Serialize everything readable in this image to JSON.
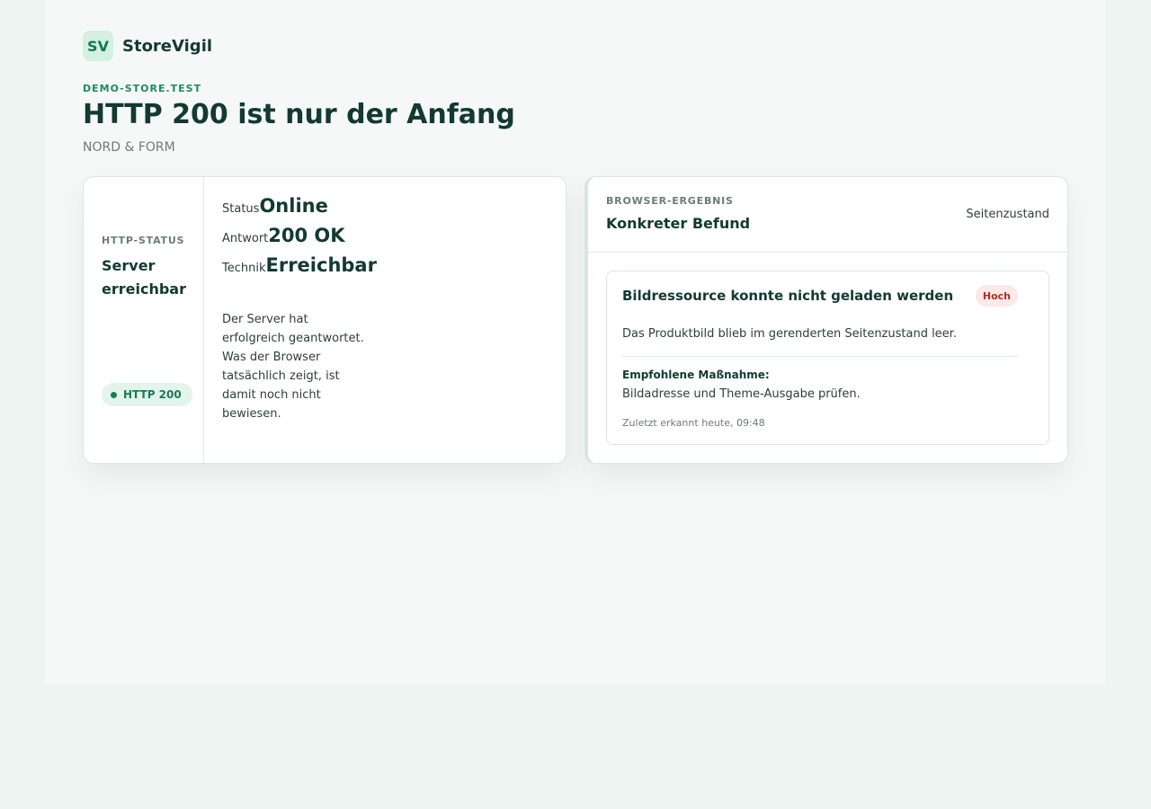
{
  "brand": {
    "logo_text": "SV",
    "name": "StoreVigil"
  },
  "header": {
    "domain": "DEMO-STORE.TEST",
    "title": "HTTP 200 ist nur der Anfang",
    "store_name": "NORD & FORM"
  },
  "http_card": {
    "label": "HTTP-STATUS",
    "title": "Server erreichbar",
    "pill": "HTTP 200",
    "rows": [
      {
        "key": "Status",
        "value": "Online"
      },
      {
        "key": "Antwort",
        "value": "200 OK"
      },
      {
        "key": "Technik",
        "value": "Erreichbar"
      }
    ],
    "description": "Der Server hat erfolgreich geantwortet. Was der Browser tatsächlich zeigt, ist damit noch nicht bewiesen."
  },
  "browser_card": {
    "label": "BROWSER-ERGEBNIS",
    "title": "Konkreter Befund",
    "state_label": "Seitenzustand",
    "finding": {
      "title": "Bildressource konnte nicht geladen werden",
      "severity": "Hoch",
      "description": "Das Produktbild blieb im gerenderten Seitenzustand leer.",
      "recommendation_label": "Empfohlene Maßnahme:",
      "recommendation": "Bildadresse und Theme-Ausgabe prüfen.",
      "last_seen": "Zuletzt erkannt heute, 09:48"
    }
  },
  "colors": {
    "accent": "#1e8a66",
    "text": "#123a2f",
    "severity_high": "#b32e24",
    "severity_high_bg": "#fde9e7",
    "success_bg": "#e3f4ec"
  }
}
